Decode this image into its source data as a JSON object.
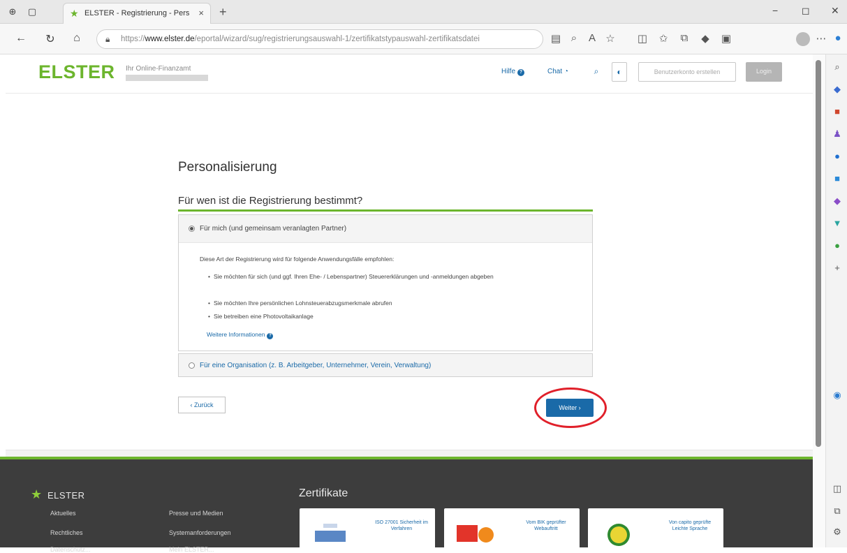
{
  "browser": {
    "tab_title": "ELSTER - Registrierung - Person...",
    "tab_close": "×",
    "new_tab": "+",
    "url_prefix": "https://",
    "url_domain": "www.elster.de",
    "url_path": "/eportal/wizard/sug/registrierungsauswahl-1/zertifikatstypauswahl-zertifikatsdatei",
    "win_minimize": "−",
    "win_restore": "◻",
    "win_close": "✕"
  },
  "header": {
    "logo": "ELSTER",
    "logo_sub": "Ihr Online-Finanzamt",
    "help_label": "Hilfe",
    "chat_label": "Chat",
    "register_label": "Benutzerkonto erstellen",
    "login_label": "Login"
  },
  "main": {
    "page_title": "Personalisierung",
    "question": "Für wen ist die Registrierung bestimmt?",
    "option1": {
      "label": "Für mich (und gemeinsam veranlagten Partner)",
      "selected": true,
      "description": "Diese Art der Registrierung wird für folgende Anwendungsfälle empfohlen:",
      "bullets": [
        "Sie möchten für sich (und ggf. Ihren Ehe- / Lebenspartner) Steuererklärungen und -anmeldungen abgeben",
        "Sie möchten Ihre persönlichen Lohnsteuerabzugsmerkmale abrufen",
        "Sie betreiben eine Photovoltaikanlage"
      ],
      "more_info": "Weitere Informationen"
    },
    "option2": {
      "label": "Für eine Organisation (z. B. Arbeitgeber, Unternehmer, Verein, Verwaltung)",
      "selected": false
    },
    "back_label": "‹ Zurück",
    "next_label": "Weiter ›"
  },
  "footer": {
    "logo": "ELSTER",
    "col1": [
      "Aktuelles",
      "Rechtliches",
      "Datenschutz..."
    ],
    "col2": [
      "Presse und Medien",
      "Systemanforderungen",
      "Mein ELSTER..."
    ],
    "certificates_title": "Zertifikate",
    "certs": [
      {
        "text": "ISO 27001 Sicherheit im Verfahren"
      },
      {
        "text": "Vom BIK geprüfter Webauftritt",
        "badge": "BIK"
      },
      {
        "text": "Von capito geprüfte Leichte Sprache",
        "badge": "LL"
      }
    ]
  },
  "colors": {
    "brand_green": "#6cb52d",
    "link_blue": "#1a6aa8",
    "highlight_red": "#e0202a",
    "footer_bg": "#3d3d3d"
  }
}
